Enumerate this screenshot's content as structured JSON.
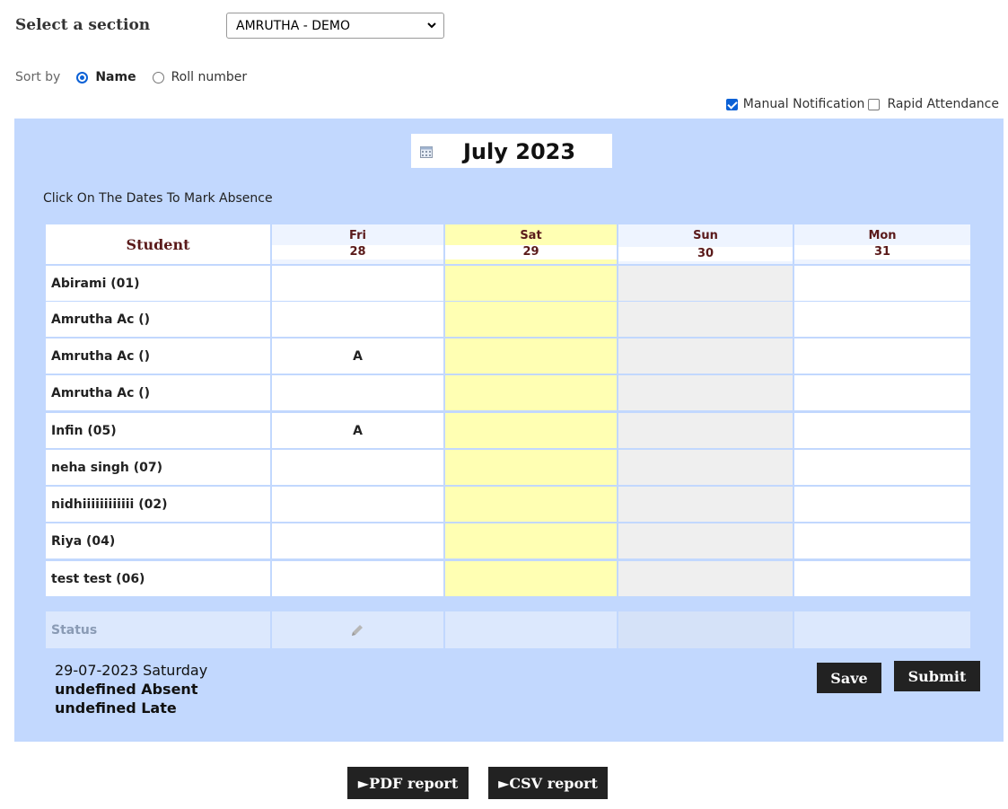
{
  "section": {
    "label": "Select a section",
    "selected": "AMRUTHA - DEMO"
  },
  "sort": {
    "label": "Sort by",
    "options": [
      "Name",
      "Roll number"
    ],
    "selected": "Name"
  },
  "options": {
    "manual_notification": "Manual Notification",
    "manual_checked": true,
    "rapid_attendance": "Rapid Attendance",
    "rapid_checked": false
  },
  "calendar": {
    "month": "July 2023",
    "instruction": "Click On The Dates To Mark Absence"
  },
  "table": {
    "student_header": "Student",
    "days": [
      {
        "day": "Fri",
        "date": "28"
      },
      {
        "day": "Sat",
        "date": "29"
      },
      {
        "day": "Sun",
        "date": "30"
      },
      {
        "day": "Mon",
        "date": "31"
      }
    ],
    "rows": [
      {
        "name": "Abirami (01)",
        "marks": [
          "",
          "",
          "",
          ""
        ]
      },
      {
        "name": "Amrutha Ac ()",
        "marks": [
          "",
          "",
          "",
          ""
        ]
      },
      {
        "name": "Amrutha Ac ()",
        "marks": [
          "A",
          "",
          "",
          ""
        ]
      },
      {
        "name": "Amrutha Ac ()",
        "marks": [
          "",
          "",
          "",
          ""
        ]
      },
      {
        "name": "Infin (05)",
        "marks": [
          "A",
          "",
          "",
          ""
        ]
      },
      {
        "name": "neha singh (07)",
        "marks": [
          "",
          "",
          "",
          ""
        ]
      },
      {
        "name": "nidhiiiiiiiiiiii (02)",
        "marks": [
          "",
          "",
          "",
          ""
        ]
      },
      {
        "name": "Riya (04)",
        "marks": [
          "",
          "",
          "",
          ""
        ]
      },
      {
        "name": "test test (06)",
        "marks": [
          "",
          "",
          "",
          ""
        ]
      }
    ],
    "status_label": "Status"
  },
  "summary": {
    "date_line": "29-07-2023 Saturday",
    "absent_line": "undefined Absent",
    "late_line": "undefined Late"
  },
  "buttons": {
    "save": "Save",
    "submit": "Submit",
    "pdf": "►PDF report",
    "csv": "►CSV report"
  },
  "colors": {
    "panel": "#c2d8fe",
    "selected_day": "#ffffb3",
    "holiday": "#efefef",
    "status_row": "#dce8fd",
    "button": "#222222"
  }
}
